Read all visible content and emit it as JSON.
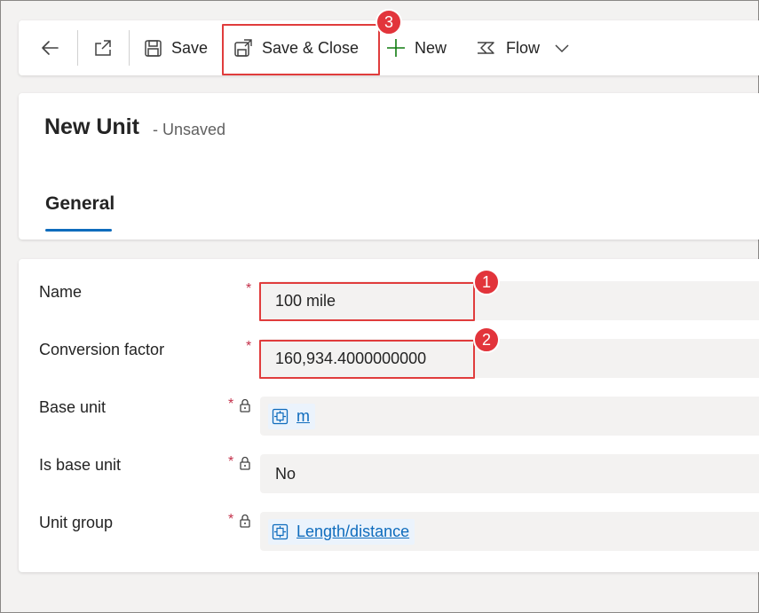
{
  "toolbar": {
    "back_icon": "arrow-left-icon",
    "popout_icon": "open-in-new-window-icon",
    "save_label": "Save",
    "save_close_label": "Save & Close",
    "new_label": "New",
    "flow_label": "Flow"
  },
  "header": {
    "title": "New Unit",
    "subtitle": "- Unsaved"
  },
  "tabs": [
    {
      "label": "General"
    }
  ],
  "form": {
    "fields": [
      {
        "label": "Name",
        "value": "100 mile",
        "required": true,
        "locked": false
      },
      {
        "label": "Conversion factor",
        "value": "160,934.4000000000",
        "required": true,
        "locked": true
      },
      {
        "label": "Base unit",
        "value": "m",
        "required": true,
        "locked": true,
        "type": "lookup"
      },
      {
        "label": "Is base unit",
        "value": "No",
        "required": true,
        "locked": true
      },
      {
        "label": "Unit group",
        "value": "Length/distance",
        "required": true,
        "locked": true,
        "type": "lookup"
      }
    ],
    "required_marker": "*"
  },
  "annotations": {
    "badge_1": "1",
    "badge_2": "2",
    "badge_3": "3"
  },
  "colors": {
    "accent": "#0f6cbd",
    "highlight": "#e03c3c",
    "badge": "#e2343b",
    "new_plus": "#107c10",
    "required": "#c4314b"
  }
}
